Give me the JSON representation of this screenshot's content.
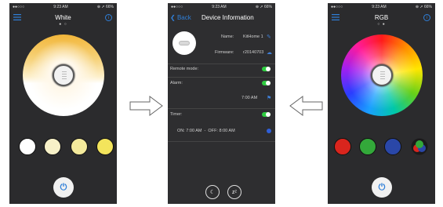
{
  "status": {
    "carrier": "●●○○○",
    "time": "9:23 AM",
    "right": "⊕ ➚ 66%"
  },
  "left_phone": {
    "title": "White",
    "page_dots": "● ○",
    "swatches": [
      "#ffffff",
      "#f7f1c8",
      "#f4ea9c",
      "#f3e45c"
    ],
    "power_symbol": "⏻",
    "menu_icon": "hamburger-menu-icon",
    "info_symbol": "i"
  },
  "middle_phone": {
    "back_label": "Back",
    "title": "Device Information",
    "name_label": "Name:",
    "name_value": "KitHome 1",
    "firmware_label": "Firmware:",
    "firmware_value": "r20140703",
    "remote_mode_label": "Remote mode:",
    "alarm_label": "Alarm:",
    "alarm_time": "7:00 AM",
    "timer_label": "Timer:",
    "timer_value": "ON: 7:00 AM  -  OFF: 8:00 AM",
    "sleep_symbol": "☾",
    "snooze_symbol": "zᶻ"
  },
  "right_phone": {
    "title": "RGB",
    "page_dots": "○ ●",
    "swatches": [
      "#d9251d",
      "#33a83a",
      "#2a47a8"
    ],
    "power_symbol": "⏻",
    "info_symbol": "i"
  }
}
